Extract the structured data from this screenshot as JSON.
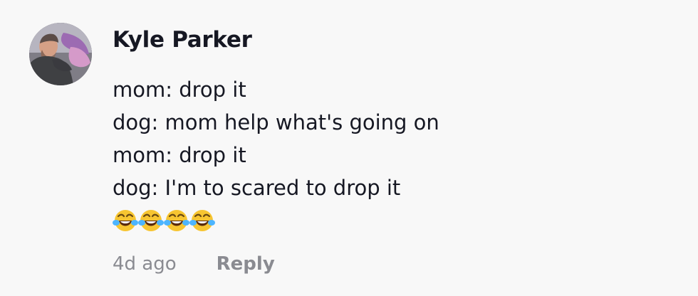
{
  "comment": {
    "username": "Kyle Parker",
    "lines": [
      "mom: drop it",
      "dog: mom help what's going on",
      "mom: drop it",
      "dog: I'm to scared to drop it"
    ],
    "emoji": {
      "icon": "face-with-tears-of-joy-icon",
      "count": 4
    },
    "timestamp": "4d ago",
    "reply_label": "Reply"
  }
}
